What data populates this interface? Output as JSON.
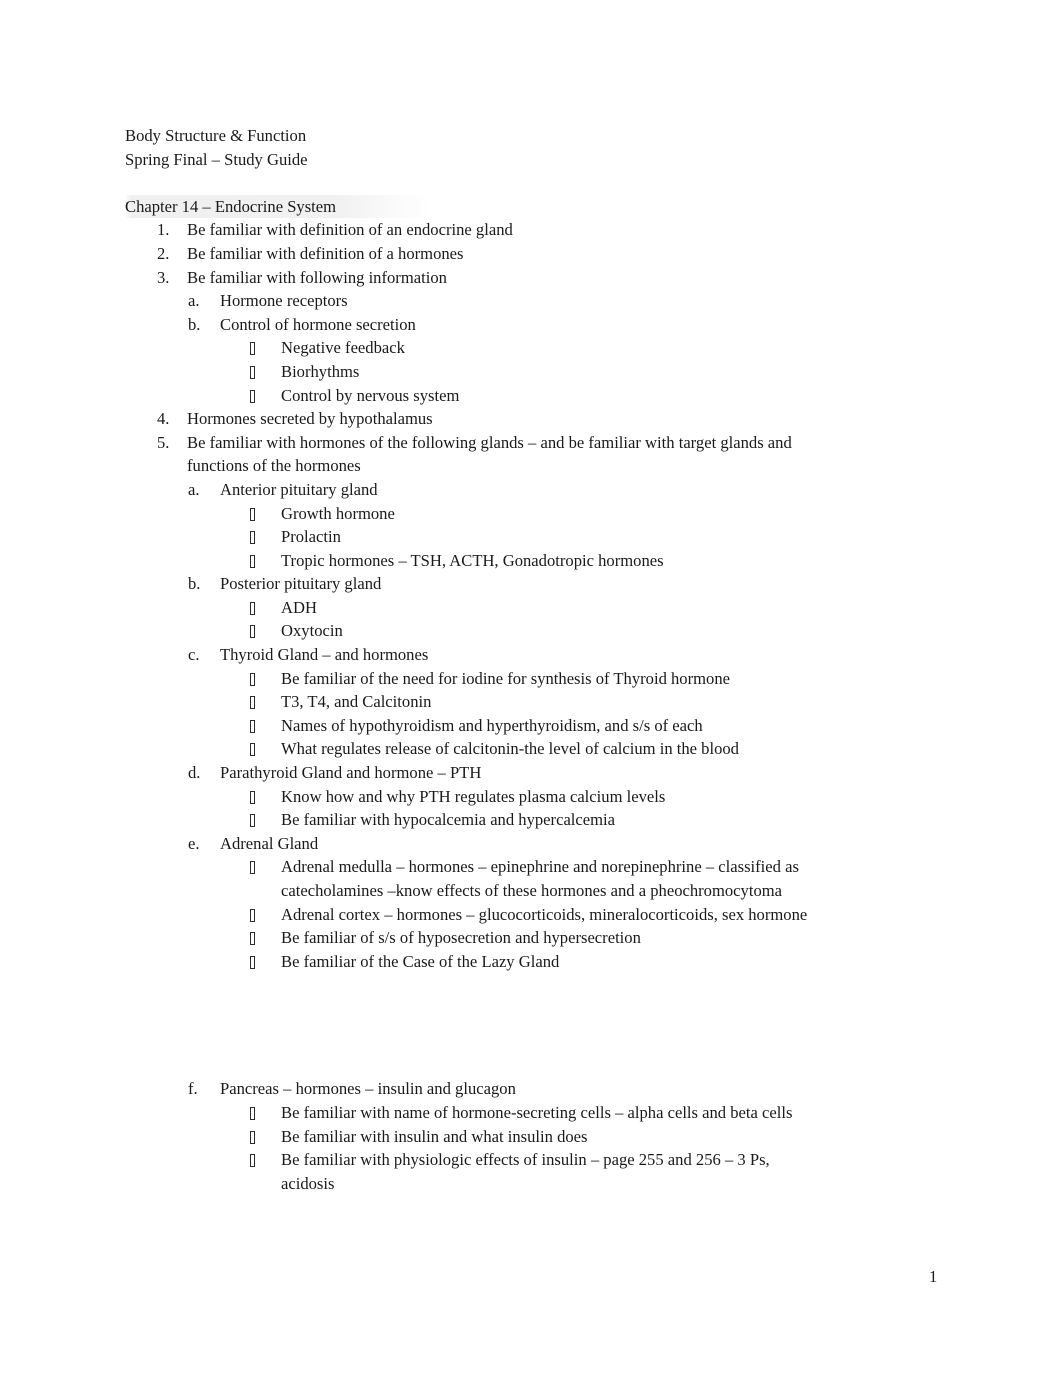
{
  "document": {
    "course_title": "Body Structure & Function",
    "subtitle": "Spring Final – Study Guide",
    "chapter_heading": "Chapter 14 – Endocrine System",
    "page_number": "1",
    "bullet_glyph_name": "missing-glyph-box"
  },
  "markers": {
    "n1": "1.",
    "n2": "2.",
    "n3": "3.",
    "n4": "4.",
    "n5": "5.",
    "a": "a.",
    "b": "b.",
    "c": "c.",
    "d": "d.",
    "e": "e.",
    "f": "f."
  },
  "outline": {
    "item1": "Be familiar with definition of an endocrine gland",
    "item2": "Be familiar with definition of a hormones",
    "item3": "Be familiar with following information",
    "item3a": "Hormone receptors",
    "item3b": "Control of hormone secretion",
    "item3b_i": "Negative feedback",
    "item3b_ii": "Biorhythms",
    "item3b_iii": "Control by nervous system",
    "item4": "Hormones secreted by hypothalamus",
    "item5": "Be familiar with hormones of the following glands – and be familiar with target glands and functions of the hormones",
    "item5a": "Anterior pituitary gland",
    "item5a_i": "Growth hormone",
    "item5a_ii": "Prolactin",
    "item5a_iii": "Tropic hormones – TSH, ACTH, Gonadotropic hormones",
    "item5b": "Posterior pituitary gland",
    "item5b_i": "ADH",
    "item5b_ii": "Oxytocin",
    "item5c": "Thyroid Gland – and hormones",
    "item5c_i": "Be familiar of the need for iodine for synthesis of Thyroid hormone",
    "item5c_ii": "T3, T4, and Calcitonin",
    "item5c_iii": "Names of hypothyroidism and hyperthyroidism, and s/s of each",
    "item5c_iv": "What regulates release of calcitonin-the level of calcium in the blood",
    "item5d": "Parathyroid Gland and hormone – PTH",
    "item5d_i": "Know how and why PTH regulates plasma calcium levels",
    "item5d_ii": "Be familiar with hypocalcemia and hypercalcemia",
    "item5e": "Adrenal Gland",
    "item5e_i": "Adrenal medulla – hormones – epinephrine and norepinephrine – classified as catecholamines –know effects of these hormones and a pheochromocytoma",
    "item5e_ii": "Adrenal cortex – hormones – glucocorticoids, mineralocorticoids, sex hormone",
    "item5e_iii": "Be familiar of s/s of hyposecretion and hypersecretion",
    "item5e_iv": "Be familiar of the Case of the Lazy Gland",
    "item5f": "Pancreas – hormones – insulin and glucagon",
    "item5f_i": "Be familiar with name of hormone-secreting cells – alpha cells and beta cells",
    "item5f_ii": "Be familiar with insulin and what insulin does",
    "item5f_iii": "Be familiar with physiologic effects of insulin – page 255 and 256 – 3 Ps, acidosis"
  }
}
